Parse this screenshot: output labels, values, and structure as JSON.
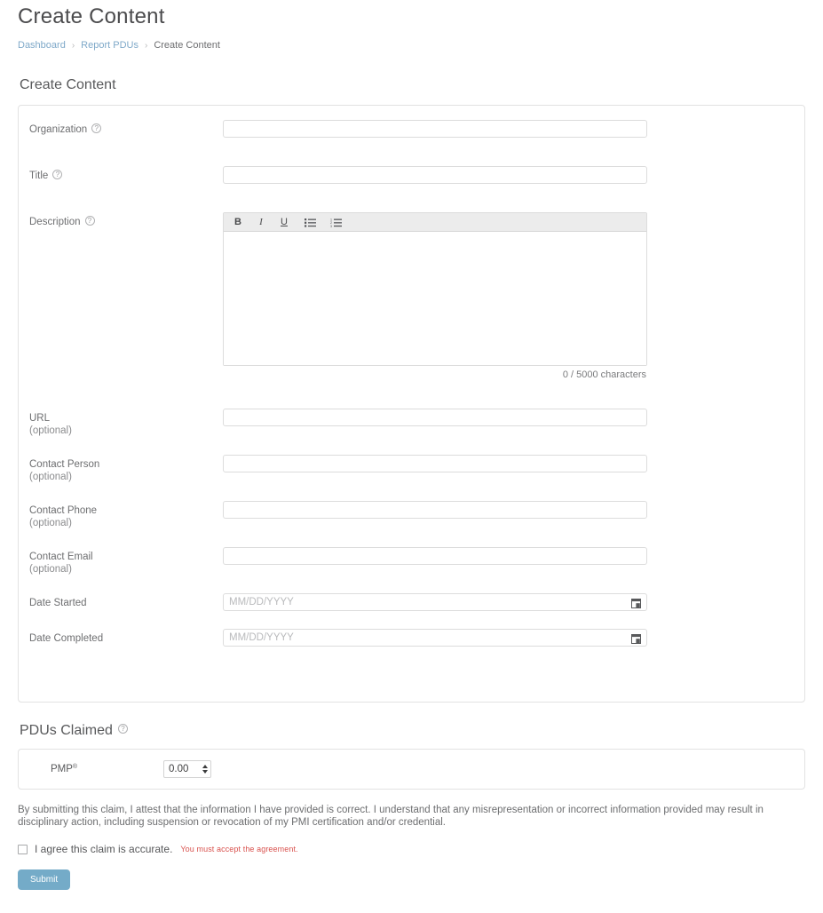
{
  "header": {
    "title": "Create Content"
  },
  "breadcrumb": {
    "items": [
      {
        "label": "Dashboard",
        "type": "link"
      },
      {
        "label": "Report PDUs",
        "type": "link"
      },
      {
        "label": "Create Content",
        "type": "current"
      }
    ],
    "separator": "›"
  },
  "section": {
    "heading": "Create Content"
  },
  "form": {
    "organization": {
      "label": "Organization",
      "has_info_icon": true,
      "value": "",
      "placeholder": ""
    },
    "title": {
      "label": "Title",
      "has_info_icon": true,
      "value": "",
      "placeholder": ""
    },
    "description": {
      "label": "Description",
      "has_info_icon": true,
      "value": "",
      "char_count": "0 / 5000 characters",
      "toolbar": [
        {
          "name": "bold",
          "glyph": "B"
        },
        {
          "name": "italic",
          "glyph": "I"
        },
        {
          "name": "underline",
          "glyph": "U"
        },
        {
          "name": "unordered-list",
          "glyph": ""
        },
        {
          "name": "ordered-list",
          "glyph": ""
        }
      ]
    },
    "url": {
      "label": "URL",
      "optional": "(optional)",
      "value": "",
      "placeholder": ""
    },
    "contact_person": {
      "label": "Contact Person",
      "optional": "(optional)",
      "value": "",
      "placeholder": ""
    },
    "contact_phone": {
      "label": "Contact Phone",
      "optional": "(optional)",
      "value": "",
      "placeholder": ""
    },
    "contact_email": {
      "label": "Contact Email",
      "optional": "(optional)",
      "value": "",
      "placeholder": ""
    },
    "date_started": {
      "label": "Date Started",
      "value": "",
      "placeholder": "MM/DD/YYYY"
    },
    "date_completed": {
      "label": "Date Completed",
      "value": "",
      "placeholder": "MM/DD/YYYY"
    }
  },
  "pdus": {
    "heading": "PDUs Claimed",
    "has_info_icon": true,
    "rows": [
      {
        "name": "PMP",
        "superscript": "®",
        "value": "0.00"
      }
    ]
  },
  "attestation": {
    "text": "By submitting this claim, I attest that the information I have provided is correct. I understand that any misrepresentation or incorrect information provided may result in disciplinary action, including suspension or revocation of my PMI certification and/or credential.",
    "agree_label": "I agree this claim is accurate.",
    "agree_checked": false,
    "error": "You must accept the agreement."
  },
  "actions": {
    "submit_label": "Submit"
  },
  "colors": {
    "link": "#7fa9c9",
    "submit_button": "#74abc8",
    "error": "#d9534f",
    "text": "#58595b",
    "border": "#e2e2e2"
  }
}
